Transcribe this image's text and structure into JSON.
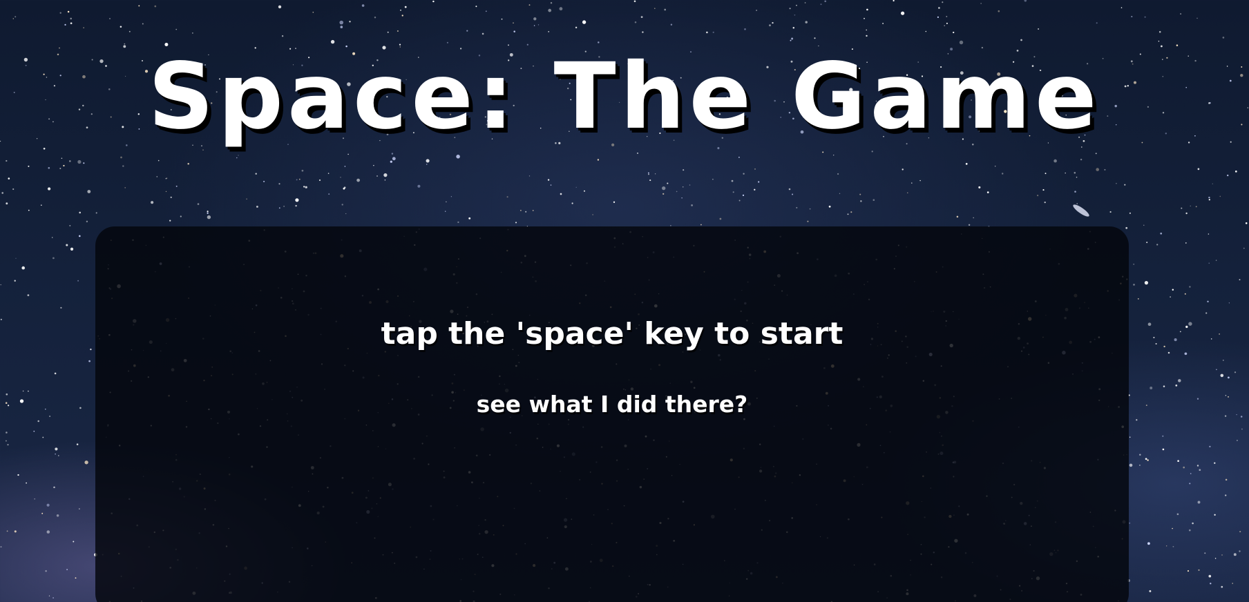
{
  "game": {
    "title": "Space: The Game",
    "start_prompt": "tap the 'space' key to start",
    "sub_prompt": "see what I did there?"
  },
  "colors": {
    "text": "#ffffff",
    "panel": "#05070d",
    "sky": "#14213b"
  }
}
